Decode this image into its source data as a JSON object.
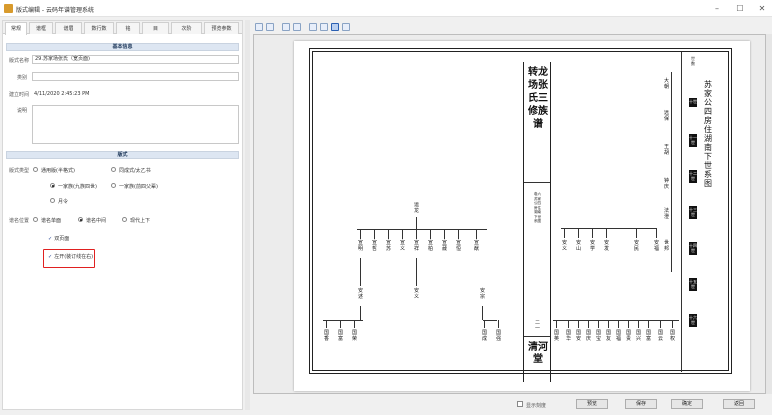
{
  "window": {
    "title": "版式编辑 - 云码年谱管理系统",
    "min": "–",
    "max": "☐",
    "close": "✕"
  },
  "tabs": [
    "常规",
    "谱框",
    "谱眉",
    "数行数",
    "铭",
    "目",
    "次阶",
    "预览参数"
  ],
  "basic": {
    "header": "基本信息",
    "name_label": "版式名称",
    "name_value": "29.苏家场张氏（宽页面)",
    "category_label": "类别",
    "category_value": "",
    "created_label": "建立时间",
    "created_value": "4/11/2020 2:45:23 PM",
    "desc_label": "说明",
    "desc_value": ""
  },
  "layout": {
    "header": "版式",
    "type_label": "版式类型",
    "type_options": [
      "通用版(半格式)",
      "同成式/太乙书",
      "一家族(九族四世)",
      "一家族(前四父辈)",
      "月令"
    ],
    "title_pos_label": "谱名位置",
    "title_pos_options": [
      "谱名单面",
      "谱名中间",
      "现代上下"
    ],
    "checkbox1": "双页面",
    "checkbox2": "左开(装订线在右)"
  },
  "genealogy": {
    "spine_title": "转龙场张氏三修族谱",
    "spine_sub": "卷六 苏家公四房住湖南下世系图",
    "spine_bottom": "清河堂",
    "spine_page": "二一",
    "right_title": "苏家公四房住湖南下世系图",
    "right_header": "世数",
    "black_tags": [
      "十世",
      "十一世",
      "十二世",
      "十三世",
      "十四世",
      "十五世",
      "十六世"
    ],
    "upper_nodes": [
      "运龙",
      "宣明",
      "宣哲",
      "宣苏",
      "宣义",
      "宣祥",
      "宣柏",
      "宣葳",
      "宣恒",
      "宣猷"
    ],
    "mid_nodes": [
      "安述",
      "安义",
      "安康",
      "安宗"
    ],
    "left_bottom_nodes": [
      "国香",
      "国富",
      "国荣",
      "国成",
      "国强"
    ],
    "right_top_nodes": [
      "大朝",
      "远保",
      "王胡",
      "钟庆",
      "法澄",
      "世邦"
    ],
    "right_mid_nodes": [
      "安义",
      "安山",
      "安学",
      "安发",
      "安民",
      "安福"
    ],
    "right_bottom_nodes": [
      "国英",
      "国华",
      "国安",
      "国庆",
      "国宝",
      "国友",
      "国福",
      "国贵",
      "国兴",
      "国富",
      "国云",
      "国权"
    ]
  },
  "bottom": {
    "show_check_label": "显示刻度",
    "preview": "预览",
    "save": "保存",
    "confirm": "确定",
    "back": "返回"
  }
}
